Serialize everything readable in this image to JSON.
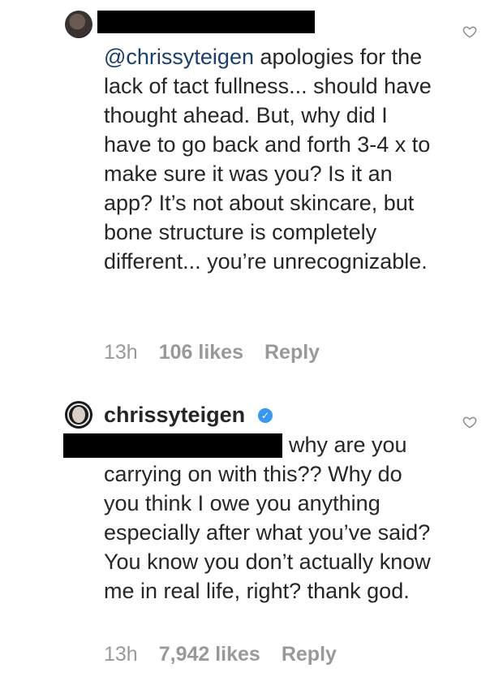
{
  "comments": [
    {
      "mention": "@chrissyteigen",
      "body": " apologies for the lack of tact fullness... should have thought ahead. But, why did I have to go back and forth 3-4 x to make sure it was you? Is it an app? It’s not about skincare, but bone structure is completely different... you’re unrecognizable.",
      "time": "13h",
      "likes": "106 likes",
      "reply": "Reply"
    },
    {
      "username": "chrissyteigen",
      "body": "why are you carrying on with this?? Why do you think I owe you anything especially after what you’ve said? You know you don’t actually know me in real life, right? thank god.",
      "time": "13h",
      "likes": "7,942 likes",
      "reply": "Reply"
    }
  ],
  "icons": {
    "like": "heart-outline-icon",
    "verified": "verified-badge-icon"
  },
  "colors": {
    "text": "#262626",
    "mention": "#1b3f6b",
    "meta": "#999999",
    "verified": "#3897f0"
  }
}
